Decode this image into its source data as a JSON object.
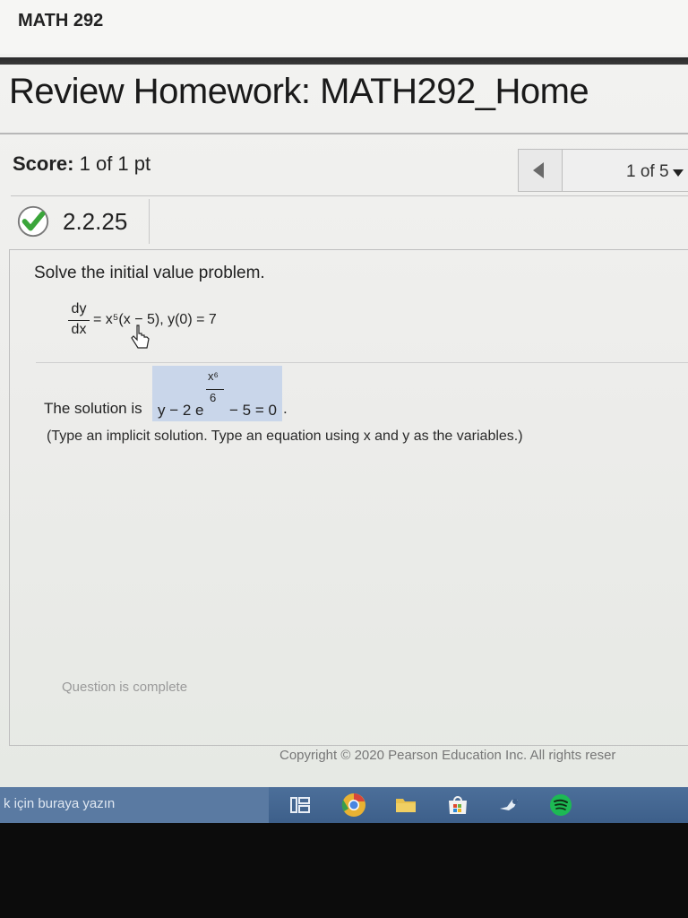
{
  "header": {
    "course": "MATH 292"
  },
  "page": {
    "title": "Review Homework: MATH292_Home"
  },
  "score": {
    "label": "Score:",
    "value": "1 of 1 pt"
  },
  "navigation": {
    "position": "1 of 5"
  },
  "question": {
    "id": "2.2.25",
    "status_icon": "check-circle-icon",
    "prompt": "Solve the initial value problem.",
    "equation": {
      "lhs_num": "dy",
      "lhs_den": "dx",
      "rhs": "= x⁵(x − 5),  y(0) = 7"
    },
    "answer_lead": "The solution is",
    "answer": {
      "prefix": "y − 2 e",
      "exp_num": "x⁶",
      "exp_den": "6",
      "suffix": "− 5 = 0"
    },
    "answer_end": ".",
    "hint": "(Type an implicit solution. Type an equation using x and y as the variables.)",
    "complete_text": "Question is complete"
  },
  "footer": {
    "copyright": "Copyright © 2020 Pearson Education Inc. All rights reser"
  },
  "taskbar": {
    "search_placeholder": "k için buraya yazın",
    "icons": [
      "task-view-icon",
      "chrome-icon",
      "file-explorer-icon",
      "store-icon",
      "steam-icon",
      "spotify-icon"
    ]
  },
  "colors": {
    "answer_highlight": "#c9d6ea",
    "check_green": "#3aa53a",
    "taskbar": "#4c6f9a"
  }
}
